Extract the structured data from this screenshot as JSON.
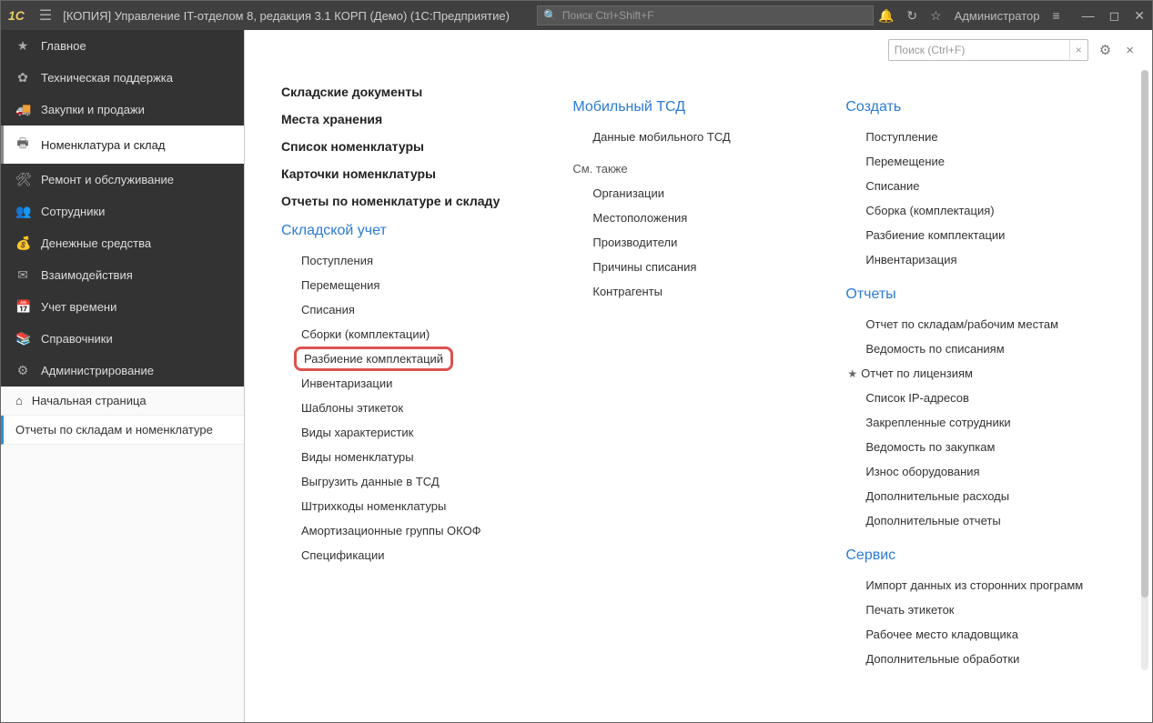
{
  "titlebar": {
    "logo": "1C",
    "title": "[КОПИЯ] Управление IT-отделом 8, редакция 3.1 КОРП (Демо)  (1С:Предприятие)",
    "global_search_placeholder": "Поиск Ctrl+Shift+F",
    "user_label": "Администратор"
  },
  "sidebar": {
    "items": [
      {
        "icon": "★",
        "label": "Главное"
      },
      {
        "icon": "✿",
        "label": "Техническая поддержка"
      },
      {
        "icon": "🚚",
        "label": "Закупки и продажи"
      },
      {
        "icon": "🖶",
        "label": "Номенклатура и склад",
        "selected": true
      },
      {
        "icon": "🛠",
        "label": "Ремонт и обслуживание"
      },
      {
        "icon": "👥",
        "label": "Сотрудники"
      },
      {
        "icon": "💰",
        "label": "Денежные средства"
      },
      {
        "icon": "✉",
        "label": "Взаимодействия"
      },
      {
        "icon": "📅",
        "label": "Учет времени"
      },
      {
        "icon": "📚",
        "label": "Справочники"
      },
      {
        "icon": "⚙",
        "label": "Администрирование"
      }
    ],
    "bottom": [
      {
        "icon": "⌂",
        "label": "Начальная страница"
      },
      {
        "icon": "",
        "label": "Отчеты по складам и номенклатуре",
        "active": true
      }
    ]
  },
  "toolbar": {
    "local_search_placeholder": "Поиск (Ctrl+F)"
  },
  "content": {
    "col1": {
      "top_bold": [
        "Складские документы",
        "Места хранения",
        "Список номенклатуры",
        "Карточки номенклатуры",
        "Отчеты по номенклатуре и складу"
      ],
      "section_head": "Складской учет",
      "links": [
        {
          "label": "Поступления"
        },
        {
          "label": "Перемещения"
        },
        {
          "label": "Списания"
        },
        {
          "label": "Сборки (комплектации)"
        },
        {
          "label": "Разбиение комплектаций",
          "highlighted": true
        },
        {
          "label": "Инвентаризации"
        },
        {
          "label": "Шаблоны этикеток"
        },
        {
          "label": "Виды характеристик"
        },
        {
          "label": "Виды номенклатуры"
        },
        {
          "label": "Выгрузить данные в ТСД"
        },
        {
          "label": "Штрихкоды номенклатуры"
        },
        {
          "label": "Амортизационные группы ОКОФ"
        },
        {
          "label": "Спецификации"
        }
      ]
    },
    "col2": {
      "head1": "Мобильный ТСД",
      "links1": [
        "Данные мобильного ТСД"
      ],
      "sub_head": "См. также",
      "links2": [
        "Организации",
        "Местоположения",
        "Производители",
        "Причины списания",
        "Контрагенты"
      ]
    },
    "col3": {
      "head1": "Создать",
      "links1": [
        "Поступление",
        "Перемещение",
        "Списание",
        "Сборка (комплектация)",
        "Разбиение комплектации",
        "Инвентаризация"
      ],
      "head2": "Отчеты",
      "links2": [
        {
          "label": "Отчет по складам/рабочим местам"
        },
        {
          "label": "Ведомость по списаниям"
        },
        {
          "label": "Отчет по лицензиям",
          "starred": true
        },
        {
          "label": "Список IP-адресов"
        },
        {
          "label": "Закрепленные сотрудники"
        },
        {
          "label": "Ведомость по закупкам"
        },
        {
          "label": "Износ оборудования"
        },
        {
          "label": "Дополнительные расходы"
        },
        {
          "label": "Дополнительные отчеты"
        }
      ],
      "head3": "Сервис",
      "links3": [
        "Импорт данных из сторонних программ",
        "Печать этикеток",
        "Рабочее место кладовщика",
        "Дополнительные обработки"
      ]
    }
  }
}
